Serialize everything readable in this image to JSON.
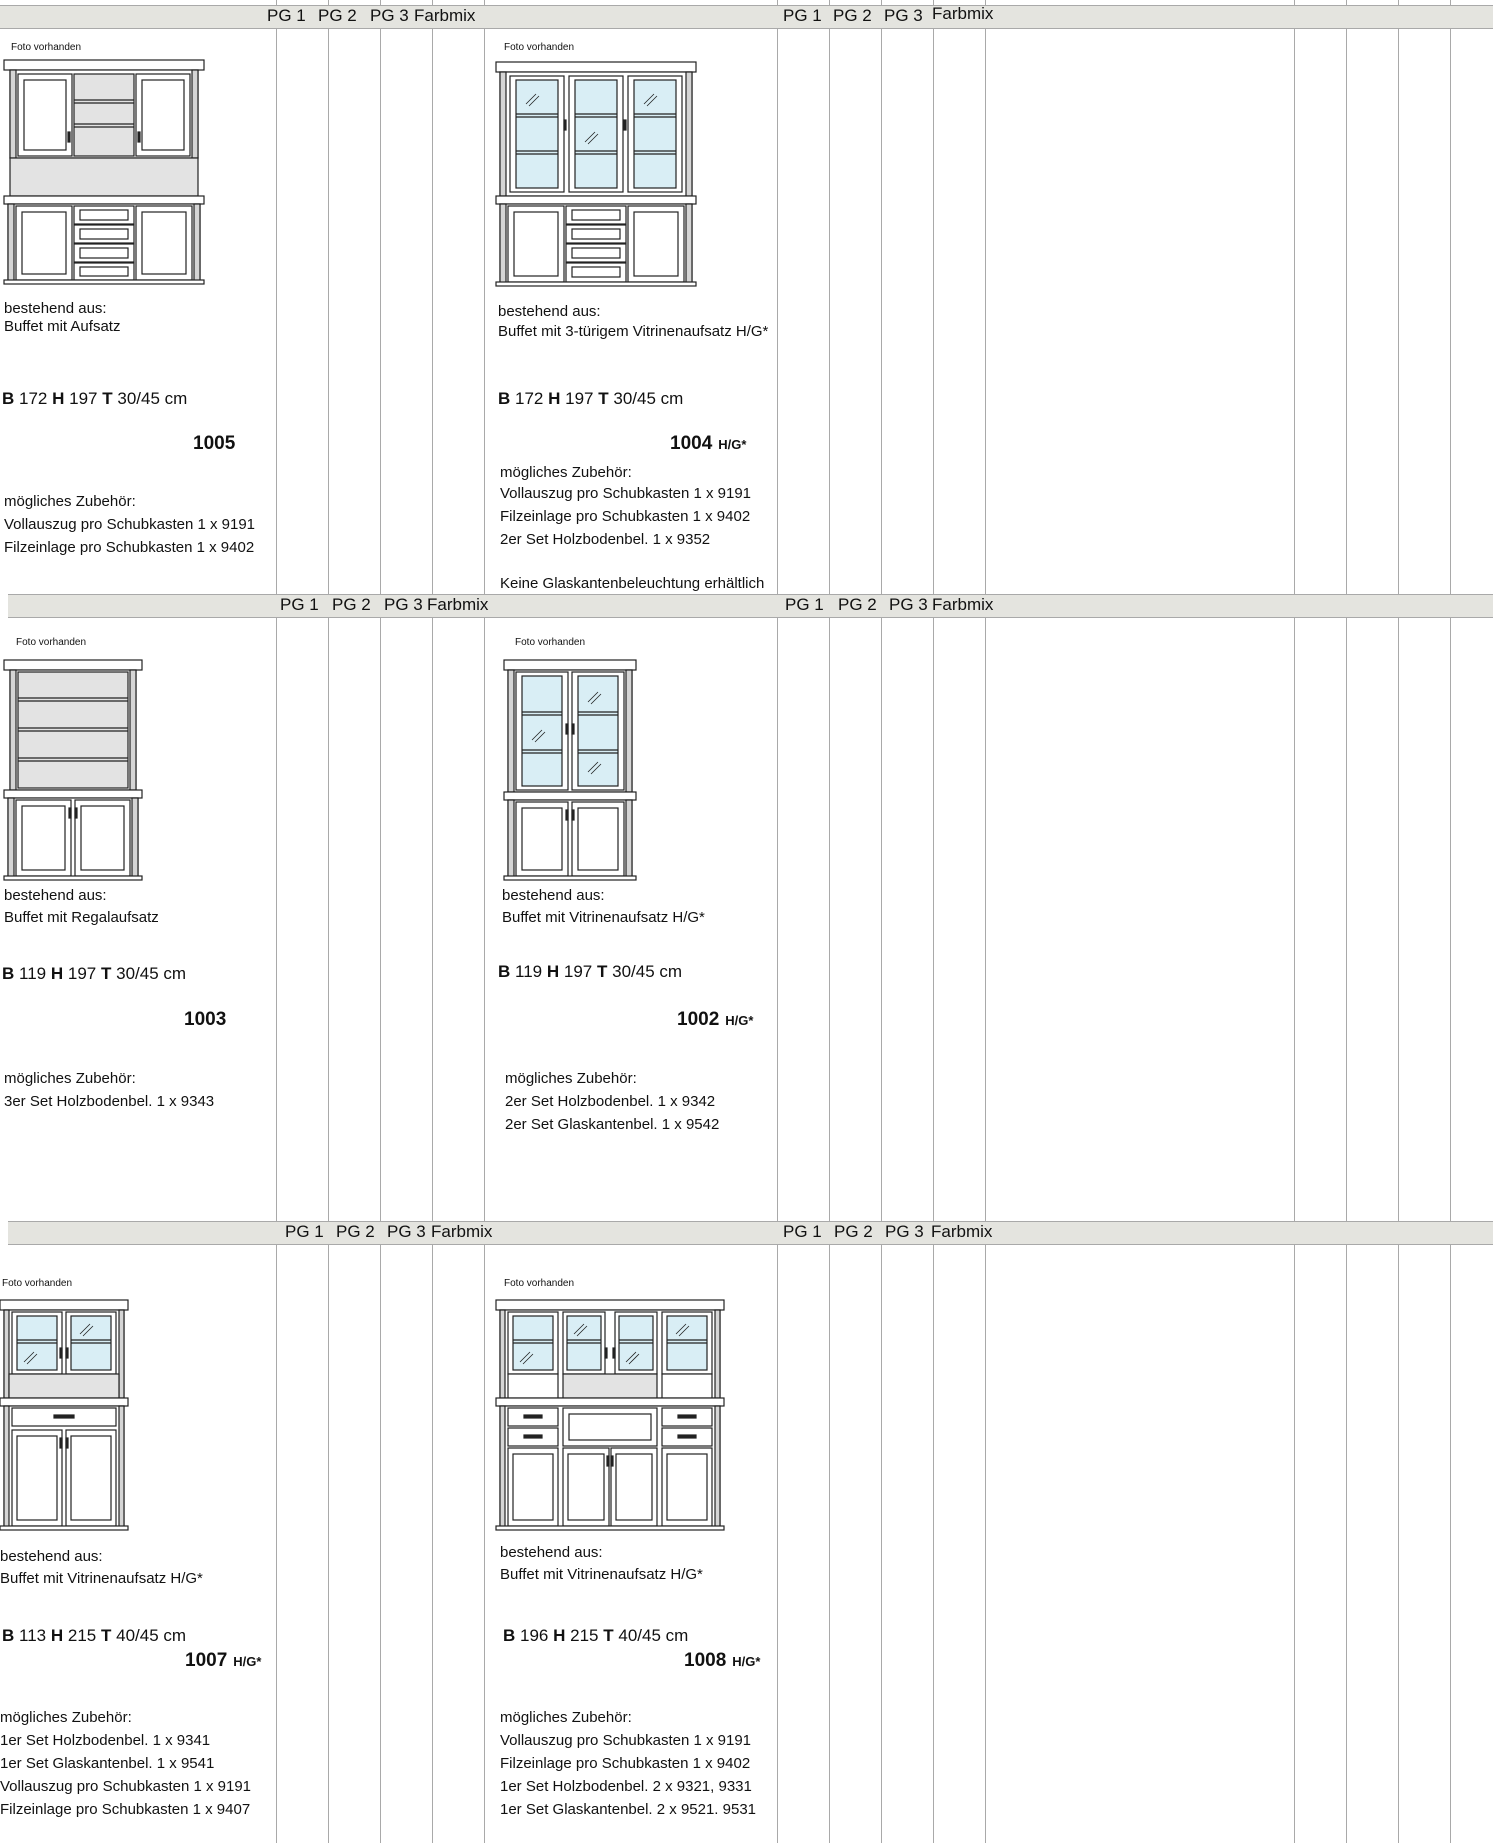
{
  "headers": {
    "pg1": "PG 1",
    "pg2": "PG 2",
    "pg3": "PG 3",
    "farbmix": "Farbmix"
  },
  "photo_label": "Foto vorhanden",
  "products": [
    {
      "consists_label": "bestehend aus:",
      "description": "Buffet mit Aufsatz",
      "dims": {
        "B": "172",
        "H": "197",
        "T": "30/45 cm"
      },
      "code": "1005",
      "suffix": "",
      "accessories_label": "mögliches Zubehör:",
      "accessories": [
        "Vollauszug pro Schubkasten 1 x 9191",
        "Filzeinlage pro Schubkasten 1 x 9402"
      ],
      "note": "",
      "icon": "buffet-with-top-cabinet-icon"
    },
    {
      "consists_label": "bestehend aus:",
      "description": "Buffet mit 3-türigem Vitrinenaufsatz H/G*",
      "dims": {
        "B": "172",
        "H": "197",
        "T": "30/45 cm"
      },
      "code": "1004",
      "suffix": "H/G*",
      "accessories_label": "mögliches Zubehör:",
      "accessories": [
        "Vollauszug pro Schubkasten 1 x 9191",
        "Filzeinlage pro Schubkasten 1 x 9402",
        "2er Set Holzbodenbel. 1 x 9352"
      ],
      "note": "Keine Glaskantenbeleuchtung erhältlich",
      "icon": "buffet-with-3-door-vitrine-icon"
    },
    {
      "consists_label": "bestehend aus:",
      "description": "Buffet mit Regalaufsatz",
      "dims": {
        "B": "119",
        "H": "197",
        "T": "30/45 cm"
      },
      "code": "1003",
      "suffix": "",
      "accessories_label": "mögliches Zubehör:",
      "accessories": [
        "3er Set Holzbodenbel. 1 x 9343"
      ],
      "note": "",
      "icon": "buffet-with-shelf-top-icon"
    },
    {
      "consists_label": "bestehend aus:",
      "description": "Buffet mit Vitrinenaufsatz H/G*",
      "dims": {
        "B": "119",
        "H": "197",
        "T": "30/45 cm"
      },
      "code": "1002",
      "suffix": "H/G*",
      "accessories_label": "mögliches Zubehör:",
      "accessories": [
        "2er Set Holzbodenbel. 1 x 9342",
        "2er Set Glaskantenbel. 1 x 9542"
      ],
      "note": "",
      "icon": "buffet-with-2-door-vitrine-icon"
    },
    {
      "consists_label": "bestehend aus:",
      "description": "Buffet mit Vitrinenaufsatz H/G*",
      "dims": {
        "B": "113",
        "H": "215",
        "T": "40/45 cm"
      },
      "code": "1007",
      "suffix": "H/G*",
      "accessories_label": "mögliches Zubehör:",
      "accessories": [
        "1er Set Holzbodenbel. 1 x 9341",
        "1er Set Glaskantenbel. 1 x 9541",
        "Vollauszug pro Schubkasten 1 x 9191",
        "Filzeinlage pro Schubkasten 1 x 9407"
      ],
      "note": "",
      "icon": "vitrine-with-drawer-buffet-icon"
    },
    {
      "consists_label": "bestehend aus:",
      "description": "Buffet mit Vitrinenaufsatz H/G*",
      "dims": {
        "B": "196",
        "H": "215",
        "T": "40/45 cm"
      },
      "code": "1008",
      "suffix": "H/G*",
      "accessories_label": "mögliches Zubehör:",
      "accessories": [
        "Vollauszug pro Schubkasten 1 x 9191",
        "Filzeinlage pro Schubkasten 1 x 9402",
        "1er Set Holzbodenbel. 2 x 9321, 9331",
        "1er Set Glaskantenbel. 2 x 9521. 9531"
      ],
      "note": "",
      "icon": "wide-vitrine-buffet-icon"
    }
  ]
}
